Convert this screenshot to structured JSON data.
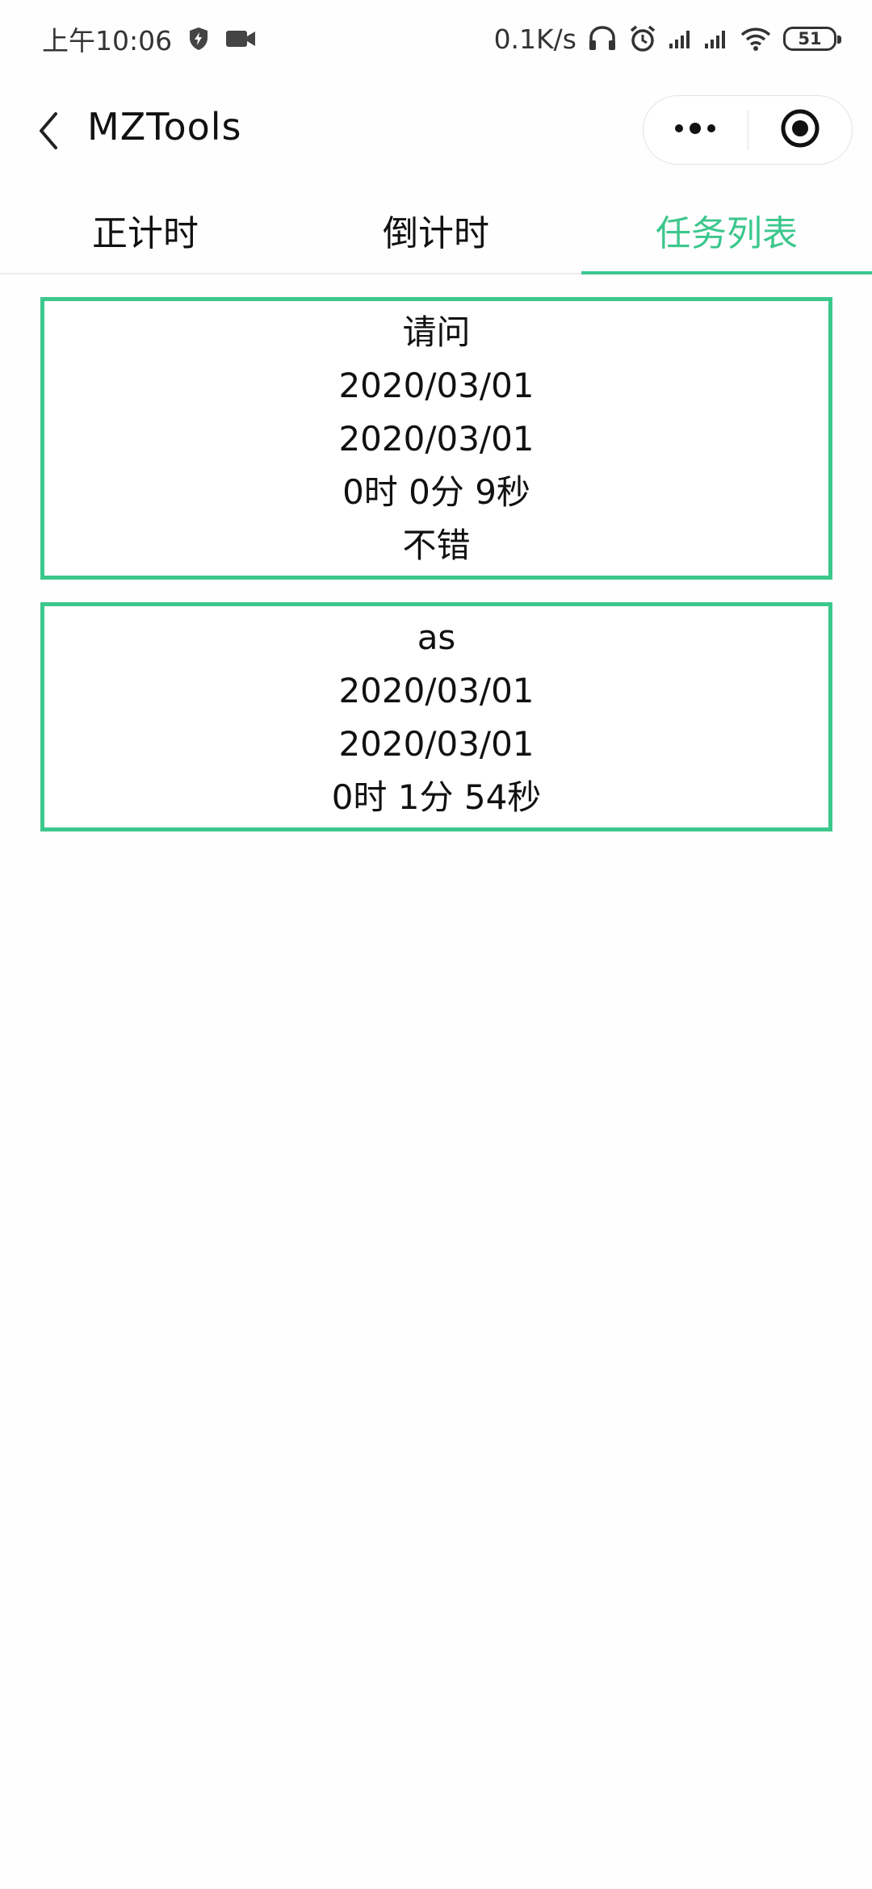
{
  "status_bar": {
    "time": "上午10:06",
    "net_speed": "0.1K/s",
    "battery": "51",
    "icons": [
      "shield-bolt-icon",
      "video-camera-icon",
      "headset-icon",
      "alarm-clock-icon",
      "signal-icon",
      "signal-icon",
      "wifi-icon",
      "battery-icon"
    ]
  },
  "nav": {
    "title": "MZTools",
    "back_icon": "chevron-left-icon",
    "more_icon": "more-dots-icon",
    "close_icon": "target-close-icon"
  },
  "tabs": [
    {
      "label": "正计时",
      "active": false
    },
    {
      "label": "倒计时",
      "active": false
    },
    {
      "label": "任务列表",
      "active": true
    }
  ],
  "colors": {
    "accent": "#3cc78d",
    "text": "#111111",
    "background": "#fefefe"
  },
  "tasks": [
    {
      "name": "请问",
      "start_date": "2020/03/01",
      "end_date": "2020/03/01",
      "duration": "0时 0分 9秒",
      "note": "不错"
    },
    {
      "name": "as",
      "start_date": "2020/03/01",
      "end_date": "2020/03/01",
      "duration": "0时 1分 54秒"
    }
  ]
}
